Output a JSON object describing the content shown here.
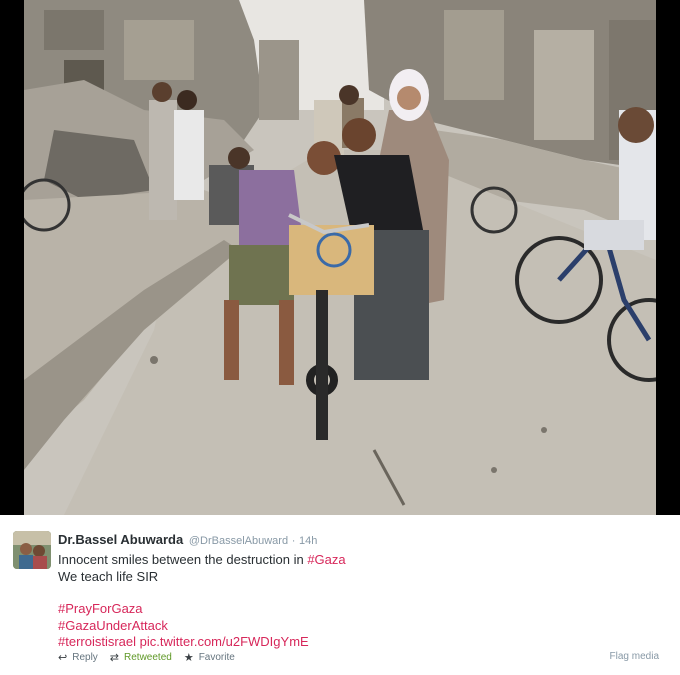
{
  "tweet": {
    "fullname": "Dr.Bassel Abuwarda",
    "username": "@DrBasselAbuward",
    "separator": "·",
    "time": "14h",
    "line1_text": "Innocent smiles between the destruction in ",
    "line1_hashtag": "#Gaza",
    "line2_text": "We teach life SIR",
    "hashtag1": "#PrayForGaza",
    "hashtag2": "#GazaUnderAttack",
    "hashtag3": "#terroistisrael",
    "link": "pic.twitter.com/u2FWDIgYmE"
  },
  "actions": {
    "reply_label": "Reply",
    "retweet_label": "Retweeted",
    "favorite_label": "Favorite",
    "flag_label": "Flag media"
  },
  "icons": {
    "reply": "reply-icon",
    "retweet": "retweet-icon",
    "favorite": "star-icon"
  },
  "colors": {
    "hashtag": "#d7275a",
    "retweeted": "#609928",
    "meta": "#8899a6"
  }
}
